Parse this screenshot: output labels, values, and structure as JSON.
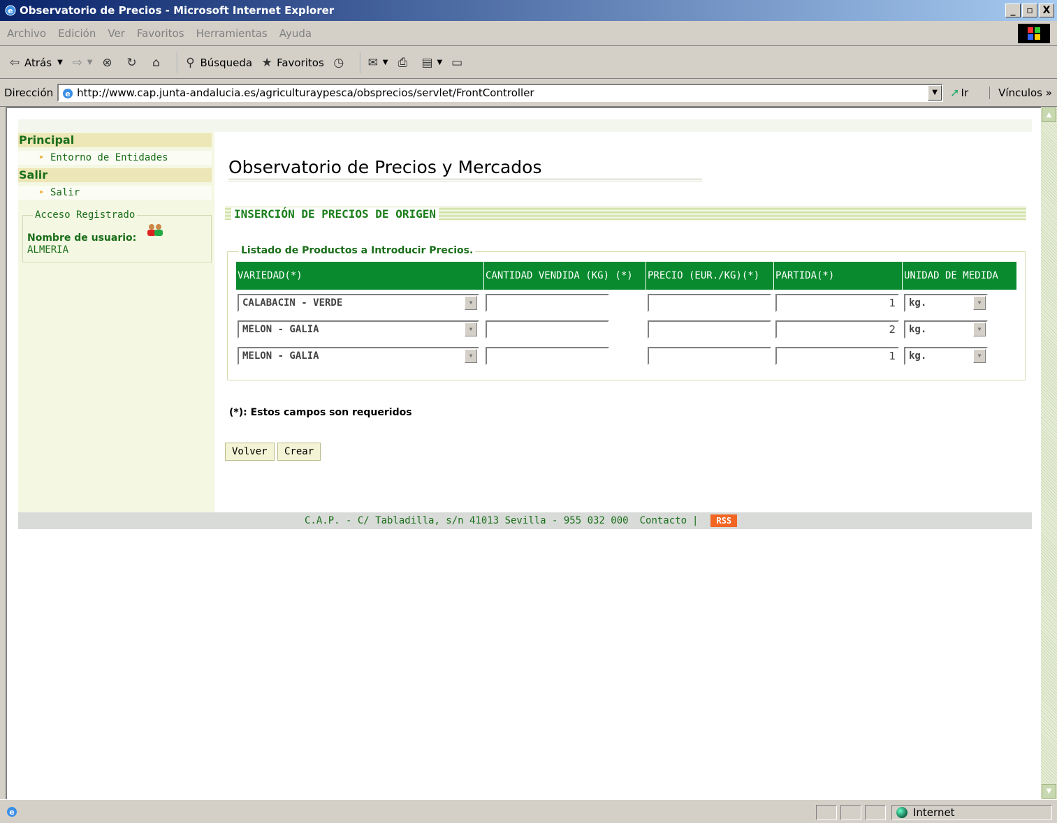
{
  "window": {
    "title": "Observatorio de Precios - Microsoft Internet Explorer",
    "controls": [
      "_",
      "▫",
      "X"
    ]
  },
  "menubar": [
    "Archivo",
    "Edición",
    "Ver",
    "Favoritos",
    "Herramientas",
    "Ayuda"
  ],
  "toolbar": {
    "back": "Atrás",
    "search": "Búsqueda",
    "favorites": "Favoritos"
  },
  "addressbar": {
    "label": "Dirección",
    "url": "http://www.cap.junta-andalucia.es/agriculturaypesca/obsprecios/servlet/FrontController",
    "go": "Ir",
    "links": "Vínculos »"
  },
  "sidebar": {
    "sections": [
      {
        "title": "Principal",
        "link": "Entorno de Entidades"
      },
      {
        "title": "Salir",
        "link": "Salir"
      }
    ],
    "access": {
      "legend": "Acceso Registrado",
      "user_label": "Nombre de usuario:",
      "user_name": "ALMERIA"
    }
  },
  "main": {
    "title": "Observatorio de Precios y Mercados",
    "section": "INSERCIÓN DE PRECIOS DE ORIGEN",
    "fieldset_legend": "Listado de Productos a Introducir Precios.",
    "columns": [
      "VARIEDAD(*)",
      "CANTIDAD VENDIDA (KG) (*)",
      "PRECIO (EUR./KG)(*)",
      "PARTIDA(*)",
      "UNIDAD DE MEDIDA"
    ],
    "rows": [
      {
        "variedad": "CALABACIN - VERDE",
        "cantidad": "",
        "precio": "",
        "partida": "1",
        "unidad": "kg."
      },
      {
        "variedad": "MELON - GALIA",
        "cantidad": "",
        "precio": "",
        "partida": "2",
        "unidad": "kg."
      },
      {
        "variedad": "MELON - GALIA",
        "cantidad": "",
        "precio": "",
        "partida": "1",
        "unidad": "kg."
      }
    ],
    "required_note": "(*): Estos campos son requeridos",
    "buttons": {
      "back": "Volver",
      "create": "Crear"
    }
  },
  "footer": {
    "address": "C.A.P. - C/ Tabladilla, s/n 41013 Sevilla - 955 032 000",
    "contact": "Contacto",
    "separator": "|",
    "rss": "RSS"
  },
  "statusbar": {
    "zone": "Internet"
  },
  "colors": {
    "header_green": "#098a2e",
    "text_green": "#1a6e1a",
    "sidebar_bg": "#f4f7e2",
    "sidebar_head": "#ede7b7",
    "rss": "#f26522"
  }
}
